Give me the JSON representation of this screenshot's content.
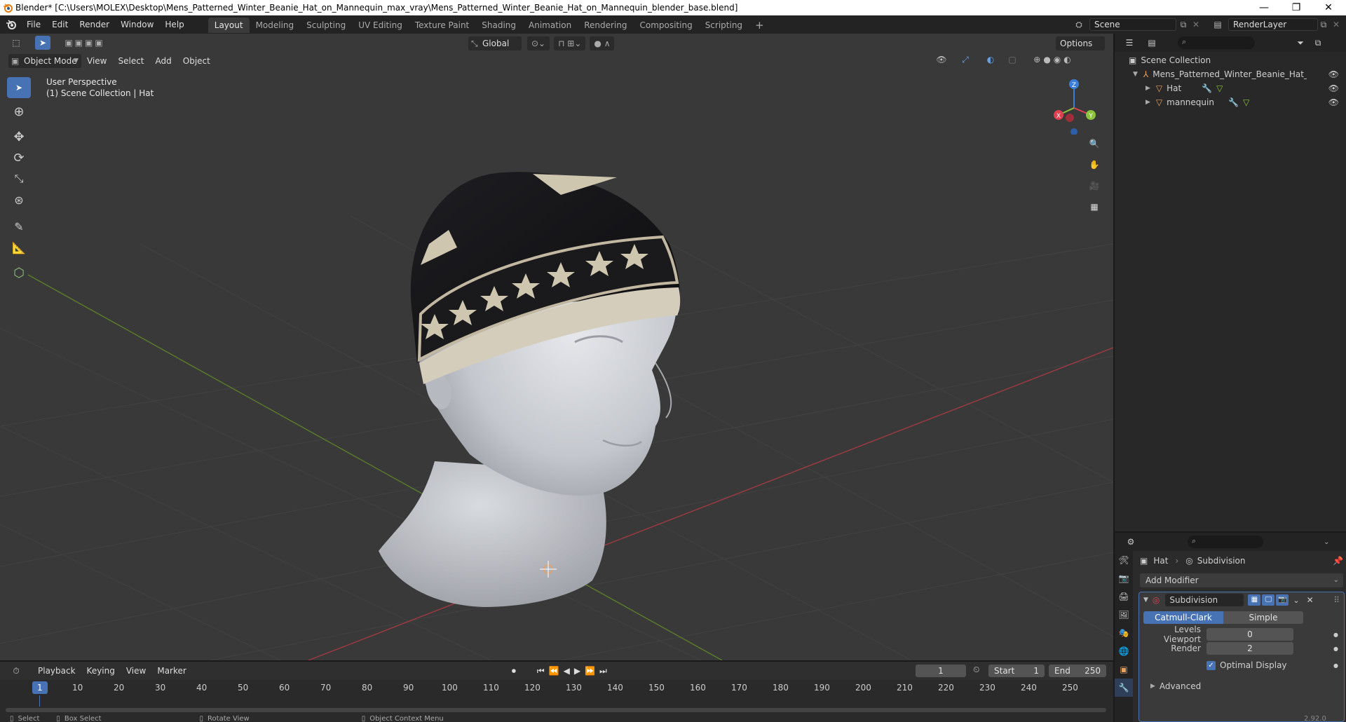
{
  "window": {
    "title": "Blender* [C:\\Users\\MOLEX\\Desktop\\Mens_Patterned_Winter_Beanie_Hat_on_Mannequin_max_vray\\Mens_Patterned_Winter_Beanie_Hat_on_Mannequin_blender_base.blend]",
    "minimize": "—",
    "maximize": "❐",
    "close": "✕"
  },
  "menubar": {
    "menus": [
      "File",
      "Edit",
      "Render",
      "Window",
      "Help"
    ],
    "workspaces": [
      "Layout",
      "Modeling",
      "Sculpting",
      "UV Editing",
      "Texture Paint",
      "Shading",
      "Animation",
      "Rendering",
      "Compositing",
      "Scripting"
    ],
    "active_workspace": "Layout",
    "add_tab": "+",
    "scene": "Scene",
    "view_layer": "RenderLayer"
  },
  "viewport_header": {
    "mode": "Object Mode",
    "menus": [
      "View",
      "Select",
      "Add",
      "Object"
    ],
    "transform_orientation": "Global",
    "options": "Options"
  },
  "viewport": {
    "perspective": "User Perspective",
    "collection_info": "(1) Scene Collection | Hat",
    "gizmo": {
      "z": "Z",
      "y": "Y",
      "x": "X"
    }
  },
  "outliner": {
    "search_placeholder": "",
    "root": "Scene Collection",
    "items": [
      {
        "name": "Mens_Patterned_Winter_Beanie_Hat_on_Mar",
        "level": 0
      },
      {
        "name": "Hat",
        "level": 1
      },
      {
        "name": "mannequin",
        "level": 1
      }
    ]
  },
  "properties": {
    "object": "Hat",
    "modifier_breadcrumb": "Subdivision",
    "add_modifier": "Add Modifier",
    "modifier": {
      "name": "Subdivision",
      "types": [
        "Catmull-Clark",
        "Simple"
      ],
      "active_type": "Catmull-Clark",
      "levels_viewport_label": "Levels Viewport",
      "levels_viewport": "0",
      "render_label": "Render",
      "render": "2",
      "optimal_display": "Optimal Display",
      "advanced": "Advanced"
    }
  },
  "timeline": {
    "menus": [
      "Playback",
      "Keying",
      "View",
      "Marker"
    ],
    "current_frame": "1",
    "start_label": "Start",
    "start": "1",
    "end_label": "End",
    "end": "250",
    "ticks": [
      "1",
      "10",
      "20",
      "30",
      "40",
      "50",
      "60",
      "70",
      "80",
      "90",
      "100",
      "110",
      "120",
      "130",
      "140",
      "150",
      "160",
      "170",
      "180",
      "190",
      "200",
      "210",
      "220",
      "230",
      "240",
      "250"
    ]
  },
  "statusbar": {
    "items": [
      "Select",
      "Box Select",
      "Rotate View",
      "Object Context Menu"
    ],
    "version": "2.92.0"
  },
  "colors": {
    "accent": "#4772b3",
    "x_axis": "#e04050",
    "y_axis": "#8cc43c",
    "z_axis": "#3b7ed8"
  }
}
